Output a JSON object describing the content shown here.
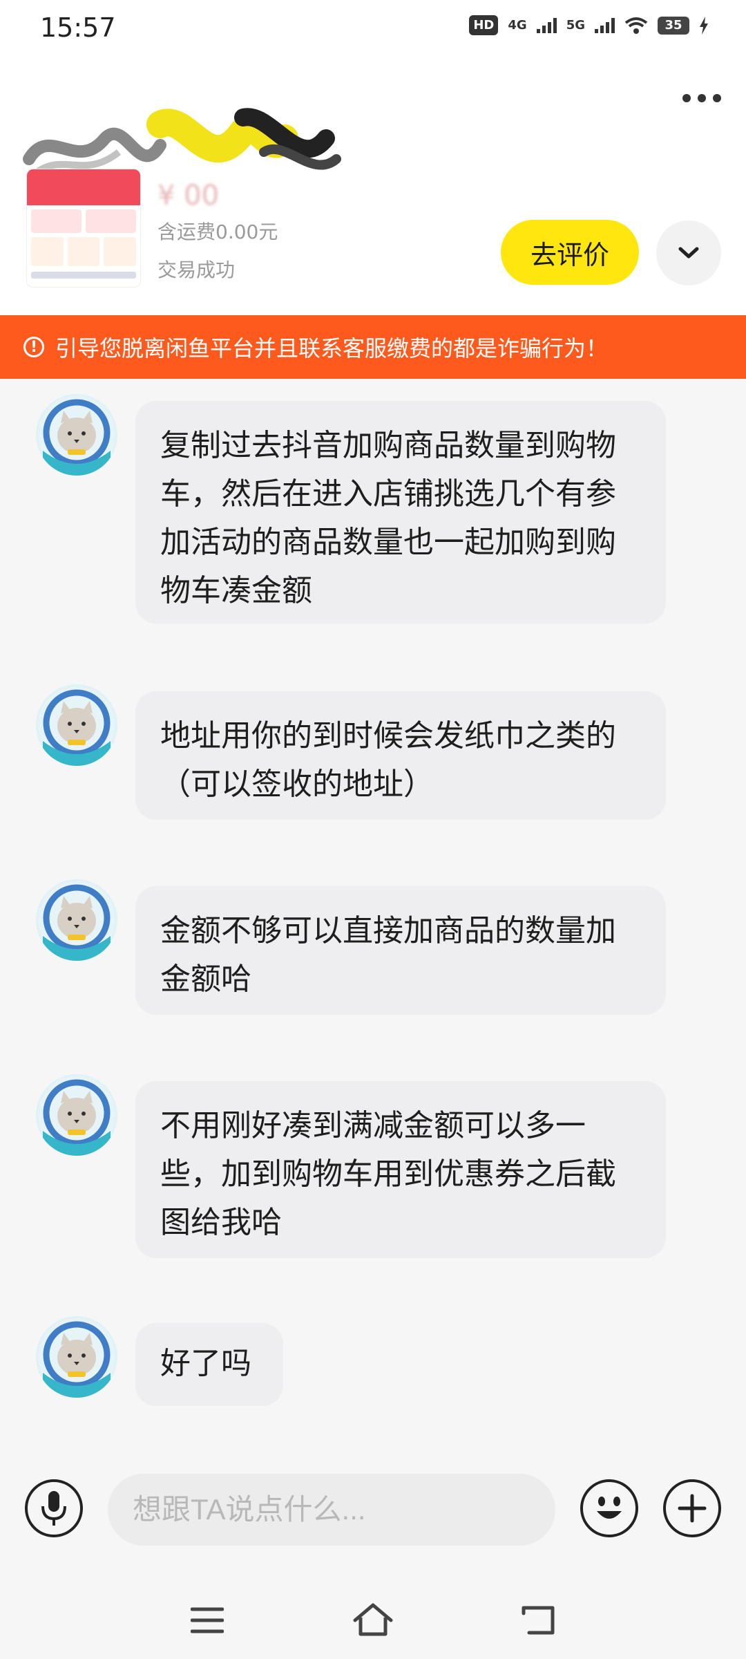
{
  "status_bar": {
    "time": "15:57",
    "hd_badge": "HD",
    "network_4g": "4G",
    "network_5g": "5G",
    "battery": "35"
  },
  "item": {
    "price": "¥ 00",
    "shipping": "含运费0.00元",
    "deal_status": "交易成功",
    "review_button": "去评价"
  },
  "warning": {
    "text": "引导您脱离闲鱼平台并且联系客服缴费的都是诈骗行为！"
  },
  "messages": [
    {
      "text": "复制过去抖音加购商品数量到购物车，然后在进入店铺挑选几个有参加活动的商品数量也一起加购到购物车凑金额"
    },
    {
      "text": "地址用你的到时候会发纸巾之类的（可以签收的地址）"
    },
    {
      "text": "金额不够可以直接加商品的数量加金额哈"
    },
    {
      "text": "不用刚好凑到满减金额可以多一些，加到购物车用到优惠券之后截图给我哈"
    },
    {
      "text": "好了吗"
    }
  ],
  "input": {
    "placeholder": "想跟TA说点什么..."
  },
  "icons": {
    "more": "more-icon",
    "expand": "chevron-down-icon",
    "warning": "exclamation-circle-icon",
    "mic": "microphone-icon",
    "emoji": "emoji-icon",
    "plus": "plus-icon",
    "menu": "menu-icon",
    "home": "home-icon",
    "back": "back-icon"
  },
  "colors": {
    "accent_yellow": "#ffe60f",
    "warning_orange": "#ff5a1e",
    "bubble_gray": "#eeeef0"
  }
}
